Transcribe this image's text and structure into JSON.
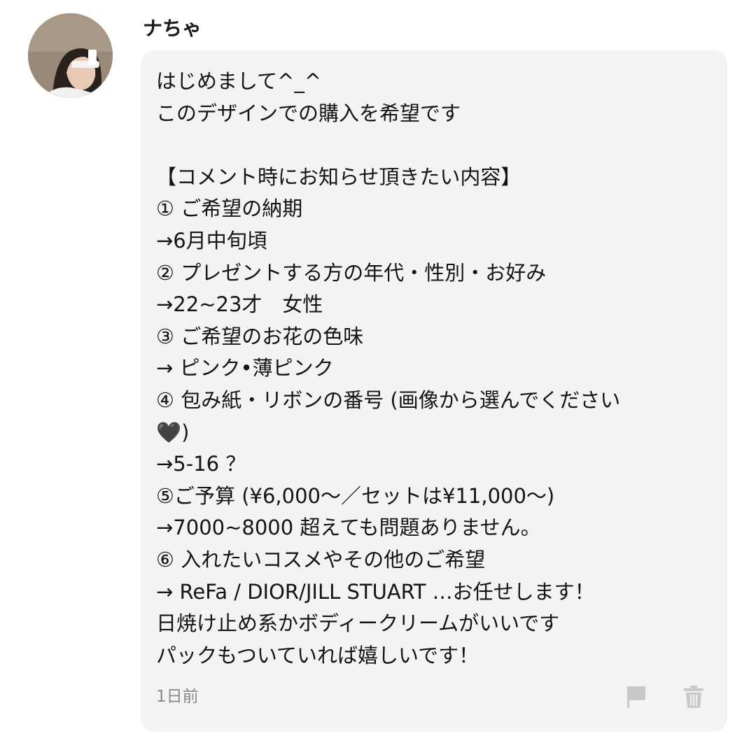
{
  "comment": {
    "author": {
      "name": "ナちゃ",
      "avatar": "avatar-photo"
    },
    "lines": [
      "はじめまして^_^",
      "このデザインでの購入を希望です",
      "",
      "【コメント時にお知らせ頂きたい内容】",
      "① ご希望の納期",
      "→6月中旬頃",
      "② プレゼントする方の年代・性別・お好み",
      "→22~23才　女性",
      "③ ご希望のお花の色味",
      "→ ピンク•薄ピンク",
      "④ 包み紙・リボンの番号 (画像から選んでください",
      "🖤)",
      "→5-16 ？",
      "⑤ご予算 (¥6,000～／セットは¥11,000～)",
      "→7000~8000 超えても問題ありません。",
      "⑥ 入れたいコスメやその他のご希望",
      "→ ReFa / DIOR/JILL STUART …お任せします！",
      "日焼け止め系かボディークリームがいいです",
      "パックもついていれば嬉しいです！"
    ],
    "timestamp": "1日前",
    "actions": {
      "report_icon": "flag-icon",
      "delete_icon": "trash-icon"
    }
  },
  "colors": {
    "bubble_background": "#f3f3f3",
    "icon_gray": "#c9c9c9",
    "timestamp_gray": "#8a8a8a"
  }
}
